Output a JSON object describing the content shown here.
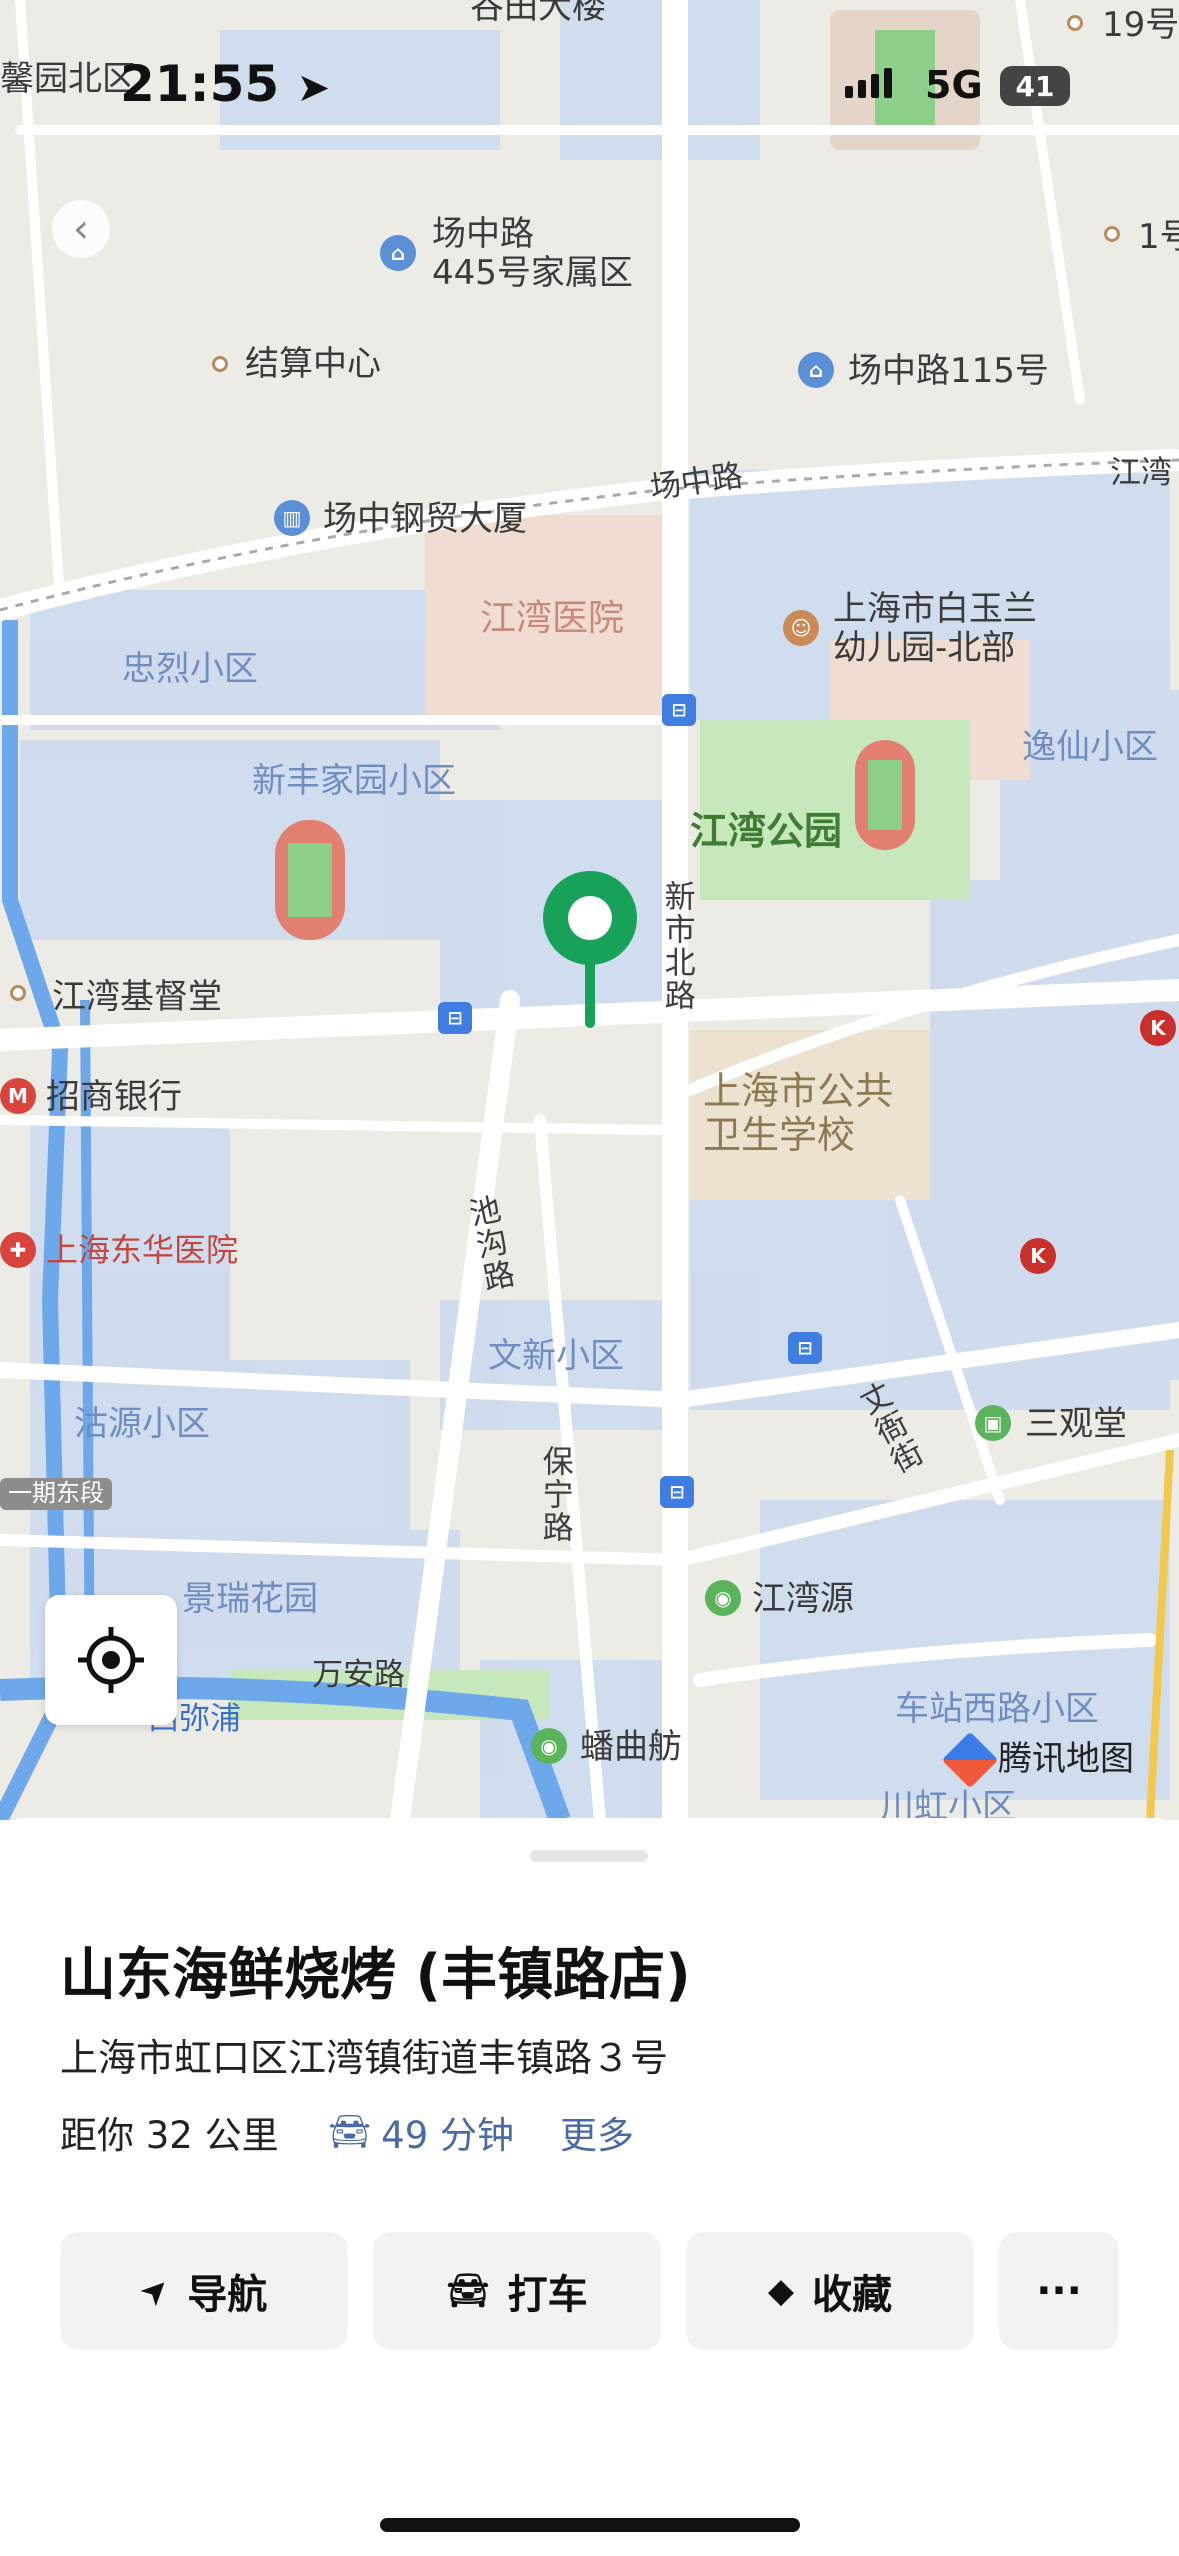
{
  "status_bar": {
    "time": "21:55",
    "network": "5G",
    "battery": "41"
  },
  "map": {
    "area_labels": [
      {
        "id": "xinfeng",
        "text": "新丰家园小区"
      },
      {
        "id": "zhonglie",
        "text": "忠烈小区"
      },
      {
        "id": "yixian",
        "text": "逸仙小区"
      },
      {
        "id": "wenxin",
        "text": "文新小区"
      },
      {
        "id": "guyuan",
        "text": "沽源小区"
      },
      {
        "id": "jingrui",
        "text": "景瑞花园"
      },
      {
        "id": "chezhan",
        "text": "车站西路小区"
      },
      {
        "id": "chuanhong",
        "text": "川虹小区"
      },
      {
        "id": "xinyuan",
        "text": "馨园北区"
      },
      {
        "id": "guwan",
        "text": "谷田大楼"
      }
    ],
    "poi_labels": [
      {
        "id": "changzhong445",
        "text": "场中路\n445号家属区",
        "icon": "home-icon"
      },
      {
        "id": "jiesuan",
        "text": "结算中心",
        "icon": "dot"
      },
      {
        "id": "changzhong115",
        "text": "场中路115号",
        "icon": "home-icon"
      },
      {
        "id": "gangmao",
        "text": "场中钢贸大厦",
        "icon": "building-icon"
      },
      {
        "id": "baiyulan",
        "text": "上海市白玉兰\n幼儿园-北部",
        "icon": "school-icon"
      },
      {
        "id": "jiangwan_church",
        "text": "江湾基督堂",
        "icon": "dot"
      },
      {
        "id": "zhaoshang",
        "text": "招商银行",
        "icon": "bank-icon"
      },
      {
        "id": "sanguantang",
        "text": "三观堂",
        "icon": "temple-icon"
      },
      {
        "id": "jiangwanyuan",
        "text": "江湾源",
        "icon": "park-icon"
      },
      {
        "id": "ququfang",
        "text": "蟠曲舫",
        "icon": "park-icon"
      },
      {
        "id": "no19",
        "text": "19号",
        "icon": "dot"
      },
      {
        "id": "no1",
        "text": "1号",
        "icon": "dot"
      }
    ],
    "school_label": "上海市公共\n卫生学校",
    "park_label": "江湾公园",
    "hospital_labels": [
      {
        "id": "jiangwan_hosp",
        "text": "江湾医院"
      },
      {
        "id": "donghua",
        "text": "上海东华医院"
      }
    ],
    "road_labels": [
      {
        "id": "changzhong",
        "text": "场中路"
      },
      {
        "id": "xinshibei",
        "text": "新市北路"
      },
      {
        "id": "chigou",
        "text": "池沟路"
      },
      {
        "id": "baoning",
        "text": "保宁路"
      },
      {
        "id": "wanan",
        "text": "万安路"
      },
      {
        "id": "xiqinpu",
        "text": "西弥浦"
      },
      {
        "id": "shaojie",
        "text": "丈衙街"
      },
      {
        "id": "jiangwan_e",
        "text": "江湾"
      },
      {
        "id": "yiqi",
        "text": "一期东段"
      }
    ],
    "brand": "腾讯地图"
  },
  "place": {
    "name": "山东海鲜烧烤 (丰镇路店)",
    "address": "上海市虹口区江湾镇街道丰镇路３号",
    "distance": "距你 32 公里",
    "drive_time": "49 分钟",
    "more": "更多"
  },
  "actions": [
    {
      "id": "navigate",
      "label": "导航",
      "icon": "navigation-arrow-icon"
    },
    {
      "id": "taxi",
      "label": "打车",
      "icon": "car-icon"
    },
    {
      "id": "favorite",
      "label": "收藏",
      "icon": "cube-icon"
    },
    {
      "id": "more",
      "label": "···",
      "icon": "ellipsis-icon"
    }
  ],
  "colors": {
    "accent_green": "#18a158",
    "link_blue": "#4a6aa5",
    "residential": "#cfdcef",
    "park": "#c7e7bd",
    "water": "#6da9ea"
  }
}
